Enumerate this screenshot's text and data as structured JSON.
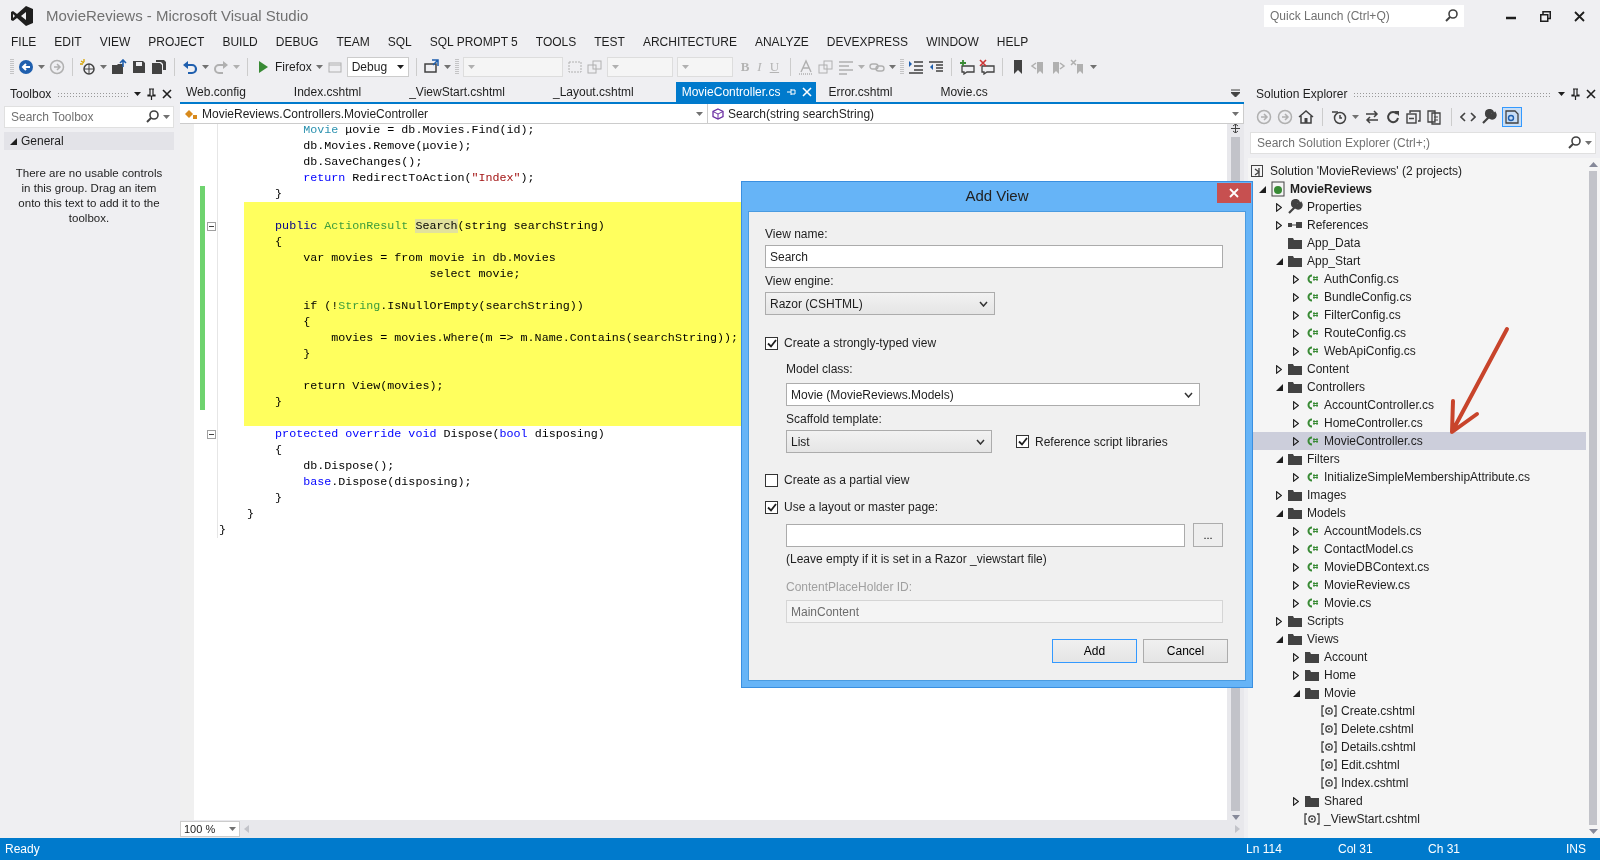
{
  "window": {
    "title": "MovieReviews - Microsoft Visual Studio",
    "quick_launch_placeholder": "Quick Launch (Ctrl+Q)"
  },
  "menu": [
    "FILE",
    "EDIT",
    "VIEW",
    "PROJECT",
    "BUILD",
    "DEBUG",
    "TEAM",
    "SQL",
    "SQL PROMPT 5",
    "TOOLS",
    "TEST",
    "ARCHITECTURE",
    "ANALYZE",
    "DEVEXPRESS",
    "WINDOW",
    "HELP"
  ],
  "toolbar": {
    "run_target": "Firefox",
    "configuration": "Debug",
    "format_buttons": [
      {
        "label": "B",
        "disabled": true
      },
      {
        "label": "I",
        "disabled": true
      },
      {
        "label": "U",
        "disabled": true
      }
    ]
  },
  "toolbox": {
    "title": "Toolbox",
    "search_placeholder": "Search Toolbox",
    "group": {
      "label": "General",
      "expanded": true
    },
    "message": "There are no usable controls in this group. Drag an item onto this text to add it to the toolbox."
  },
  "editor": {
    "tabs": [
      {
        "label": "Web.config",
        "selected": false
      },
      {
        "label": "Index.cshtml",
        "selected": false
      },
      {
        "label": "_ViewStart.cshtml",
        "selected": false
      },
      {
        "label": "_Layout.cshtml",
        "selected": false
      },
      {
        "label": "MovieController.cs",
        "selected": true
      },
      {
        "label": "Error.cshtml",
        "selected": false
      },
      {
        "label": "Movie.cs",
        "selected": false
      }
    ],
    "type_dropdown": "MovieReviews.Controllers.MovieController",
    "member_dropdown": "Search(string searchString)",
    "lines": [
      {
        "tokens": [
          {
            "kind": "type",
            "text": "            Movie"
          },
          {
            "kind": "plain",
            "text": " μovie = db.Movies.Find(id);"
          }
        ],
        "highlighted": false,
        "changed": false
      },
      {
        "tokens": [
          {
            "kind": "plain",
            "text": "            db.Movies.Remove(μovie);"
          }
        ],
        "highlighted": false,
        "changed": false
      },
      {
        "tokens": [
          {
            "kind": "plain",
            "text": "            db.SaveChanges();"
          }
        ],
        "highlighted": false,
        "changed": false
      },
      {
        "tokens": [
          {
            "kind": "keyword",
            "text": "            return"
          },
          {
            "kind": "plain",
            "text": " RedirectToAction("
          },
          {
            "kind": "string",
            "text": "\"Index\""
          },
          {
            "kind": "plain",
            "text": ");"
          }
        ],
        "highlighted": false,
        "changed": false
      },
      {
        "tokens": [
          {
            "kind": "plain",
            "text": "        }"
          }
        ],
        "highlighted": false,
        "changed": true
      },
      {
        "highlighted": true,
        "changed": true
      },
      {
        "tokens": [
          {
            "kind": "keyword",
            "text": "        public "
          },
          {
            "kind": "type",
            "text": "ActionResult "
          },
          {
            "kind": "reference",
            "text": "Search"
          },
          {
            "kind": "plain",
            "text": "(string searchString)"
          }
        ],
        "highlighted": true,
        "changed": true,
        "collapsible": true
      },
      {
        "tokens": [
          {
            "kind": "plain",
            "text": "        {"
          }
        ],
        "highlighted": true,
        "changed": true
      },
      {
        "tokens": [
          {
            "kind": "plain",
            "text": "            var movies = from movie in db.Movies"
          }
        ],
        "highlighted": true,
        "changed": true
      },
      {
        "tokens": [
          {
            "kind": "plain",
            "text": "                              select movie;"
          }
        ],
        "highlighted": true,
        "changed": true
      },
      {
        "highlighted": true,
        "changed": true
      },
      {
        "tokens": [
          {
            "kind": "plain",
            "text": "            if (!"
          },
          {
            "kind": "type",
            "text": "String"
          },
          {
            "kind": "plain",
            "text": ".IsNullOrEmpty(searchString))"
          }
        ],
        "highlighted": true,
        "changed": true
      },
      {
        "tokens": [
          {
            "kind": "plain",
            "text": "            {"
          }
        ],
        "highlighted": true,
        "changed": true
      },
      {
        "tokens": [
          {
            "kind": "plain",
            "text": "                movies = movies.Where(m => m.Name.Contains(searchString));"
          }
        ],
        "highlighted": true,
        "changed": true
      },
      {
        "tokens": [
          {
            "kind": "plain",
            "text": "            }"
          }
        ],
        "highlighted": true,
        "changed": true
      },
      {
        "highlighted": true,
        "changed": true
      },
      {
        "tokens": [
          {
            "kind": "plain",
            "text": "            return View(movies);"
          }
        ],
        "highlighted": true,
        "changed": true
      },
      {
        "tokens": [
          {
            "kind": "plain",
            "text": "        }"
          }
        ],
        "highlighted": true,
        "changed": true
      },
      {
        "highlighted": true,
        "changed": false
      },
      {
        "tokens": [
          {
            "kind": "keyword",
            "text": "        protected override void"
          },
          {
            "kind": "plain",
            "text": " Dispose("
          },
          {
            "kind": "keyword",
            "text": "bool"
          },
          {
            "kind": "plain",
            "text": " disposing)"
          }
        ],
        "highlighted": false,
        "changed": false,
        "collapsible": true
      },
      {
        "tokens": [
          {
            "kind": "plain",
            "text": "        {"
          }
        ],
        "highlighted": false,
        "changed": false
      },
      {
        "tokens": [
          {
            "kind": "plain",
            "text": "            db.Dispose();"
          }
        ],
        "highlighted": false,
        "changed": false
      },
      {
        "tokens": [
          {
            "kind": "keyword",
            "text": "            base"
          },
          {
            "kind": "plain",
            "text": ".Dispose(disposing);"
          }
        ],
        "highlighted": false,
        "changed": false
      },
      {
        "tokens": [
          {
            "kind": "plain",
            "text": "        }"
          }
        ],
        "highlighted": false,
        "changed": false
      },
      {
        "tokens": [
          {
            "kind": "plain",
            "text": "    }"
          }
        ],
        "highlighted": false,
        "changed": false
      },
      {
        "tokens": [
          {
            "kind": "plain",
            "text": "}"
          }
        ],
        "highlighted": false,
        "changed": false
      }
    ],
    "zoom": "100 %"
  },
  "dialog": {
    "title": "Add View",
    "view_name": {
      "label": "View name:",
      "value": "Search"
    },
    "view_engine": {
      "label": "View engine:",
      "value": "Razor (CSHTML)"
    },
    "strongly_typed": {
      "label": "Create a strongly-typed view",
      "checked": true
    },
    "model_class": {
      "label": "Model class:",
      "value": "Movie (MovieReviews.Models)"
    },
    "scaffold_template": {
      "label": "Scaffold template:",
      "value": "List"
    },
    "reference_scripts": {
      "label": "Reference script libraries",
      "checked": true
    },
    "partial_view": {
      "label": "Create as a partial view",
      "checked": false
    },
    "use_layout": {
      "label": "Use a layout or master page:",
      "checked": true
    },
    "browse_button": "...",
    "layout_hint": "(Leave empty if it is set in a Razor _viewstart file)",
    "content_placeholder": {
      "label": "ContentPlaceHolder ID:",
      "value": "MainContent",
      "disabled": true
    },
    "buttons": [
      {
        "label": "Add",
        "default": true
      },
      {
        "label": "Cancel",
        "default": false
      }
    ]
  },
  "solution_explorer": {
    "title": "Solution Explorer",
    "search_placeholder": "Search Solution Explorer (Ctrl+;)",
    "solution": "Solution 'MovieReviews' (2 projects)",
    "tree": [
      {
        "label": "MovieReviews",
        "kind": "project",
        "expanded": true,
        "selected": false,
        "children": [
          {
            "label": "Properties",
            "kind": "properties",
            "expanded": false,
            "selected": false
          },
          {
            "label": "References",
            "kind": "references",
            "expanded": false,
            "selected": false
          },
          {
            "label": "App_Data",
            "kind": "folder",
            "selected": false
          },
          {
            "label": "App_Start",
            "kind": "folder",
            "expanded": true,
            "selected": false,
            "children": [
              {
                "label": "AuthConfig.cs",
                "kind": "csharp",
                "expanded": false,
                "selected": false
              },
              {
                "label": "BundleConfig.cs",
                "kind": "csharp",
                "expanded": false,
                "selected": false
              },
              {
                "label": "FilterConfig.cs",
                "kind": "csharp",
                "expanded": false,
                "selected": false
              },
              {
                "label": "RouteConfig.cs",
                "kind": "csharp",
                "expanded": false,
                "selected": false
              },
              {
                "label": "WebApiConfig.cs",
                "kind": "csharp",
                "expanded": false,
                "selected": false
              }
            ]
          },
          {
            "label": "Content",
            "kind": "folder",
            "expanded": false,
            "selected": false
          },
          {
            "label": "Controllers",
            "kind": "folder",
            "expanded": true,
            "selected": false,
            "children": [
              {
                "label": "AccountController.cs",
                "kind": "csharp",
                "expanded": false,
                "selected": false
              },
              {
                "label": "HomeController.cs",
                "kind": "csharp",
                "expanded": false,
                "selected": false
              },
              {
                "label": "MovieController.cs",
                "kind": "csharp",
                "expanded": false,
                "selected": true
              }
            ]
          },
          {
            "label": "Filters",
            "kind": "folder",
            "expanded": true,
            "selected": false,
            "children": [
              {
                "label": "InitializeSimpleMembershipAttribute.cs",
                "kind": "csharp",
                "expanded": false,
                "selected": false
              }
            ]
          },
          {
            "label": "Images",
            "kind": "folder",
            "expanded": false,
            "selected": false
          },
          {
            "label": "Models",
            "kind": "folder",
            "expanded": true,
            "selected": false,
            "children": [
              {
                "label": "AccountModels.cs",
                "kind": "csharp",
                "expanded": false,
                "selected": false
              },
              {
                "label": "ContactModel.cs",
                "kind": "csharp",
                "expanded": false,
                "selected": false
              },
              {
                "label": "MovieDBContext.cs",
                "kind": "csharp",
                "expanded": false,
                "selected": false
              },
              {
                "label": "MovieReview.cs",
                "kind": "csharp",
                "expanded": false,
                "selected": false
              },
              {
                "label": "Movie.cs",
                "kind": "csharp",
                "expanded": false,
                "selected": false
              }
            ]
          },
          {
            "label": "Scripts",
            "kind": "folder",
            "expanded": false,
            "selected": false
          },
          {
            "label": "Views",
            "kind": "folder",
            "expanded": true,
            "selected": false,
            "children": [
              {
                "label": "Account",
                "kind": "folder",
                "expanded": false,
                "selected": false
              },
              {
                "label": "Home",
                "kind": "folder",
                "expanded": false,
                "selected": false
              },
              {
                "label": "Movie",
                "kind": "folder",
                "expanded": true,
                "selected": false,
                "children": [
                  {
                    "label": "Create.cshtml",
                    "kind": "razor",
                    "selected": false
                  },
                  {
                    "label": "Delete.cshtml",
                    "kind": "razor",
                    "selected": false
                  },
                  {
                    "label": "Details.cshtml",
                    "kind": "razor",
                    "selected": false
                  },
                  {
                    "label": "Edit.cshtml",
                    "kind": "razor",
                    "selected": false
                  },
                  {
                    "label": "Index.cshtml",
                    "kind": "razor",
                    "selected": false
                  }
                ]
              },
              {
                "label": "Shared",
                "kind": "folder",
                "expanded": false,
                "selected": false
              },
              {
                "label": "_ViewStart.cshtml",
                "kind": "razor",
                "selected": false
              }
            ]
          }
        ]
      }
    ]
  },
  "status_bar": {
    "message": "Ready",
    "line": "Ln 114",
    "column": "Col 31",
    "char": "Ch 31",
    "mode": "INS"
  }
}
